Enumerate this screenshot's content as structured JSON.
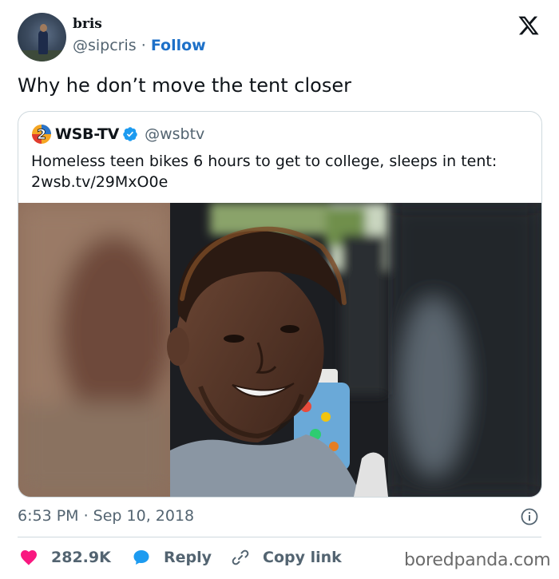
{
  "author": {
    "display_name": "bris",
    "handle": "@sipcris",
    "separator": "·",
    "follow_label": "Follow"
  },
  "tweet": {
    "text": "Why he don’t move the tent closer",
    "timestamp": "6:53 PM · Sep 10, 2018"
  },
  "quoted": {
    "logo_digit": "2",
    "name": "WSB-TV",
    "handle": "@wsbtv",
    "text_line1": "Homeless teen bikes 6 hours to get to college, sleeps in tent:",
    "text_line2": "2wsb.tv/29MxO0e"
  },
  "actions": {
    "likes": "282.9K",
    "reply_label": "Reply",
    "copy_link_label": "Copy link"
  },
  "watermark": "boredpanda.com",
  "colors": {
    "like_heart": "#f91880",
    "reply_bubble": "#1d9bf0",
    "follow_link": "#1d70c8",
    "verified_badge": "#1d9bf0",
    "text_secondary": "#536471"
  },
  "icons": [
    "x-logo-icon",
    "verified-badge-icon",
    "info-icon",
    "heart-icon",
    "reply-bubble-icon",
    "link-icon"
  ]
}
